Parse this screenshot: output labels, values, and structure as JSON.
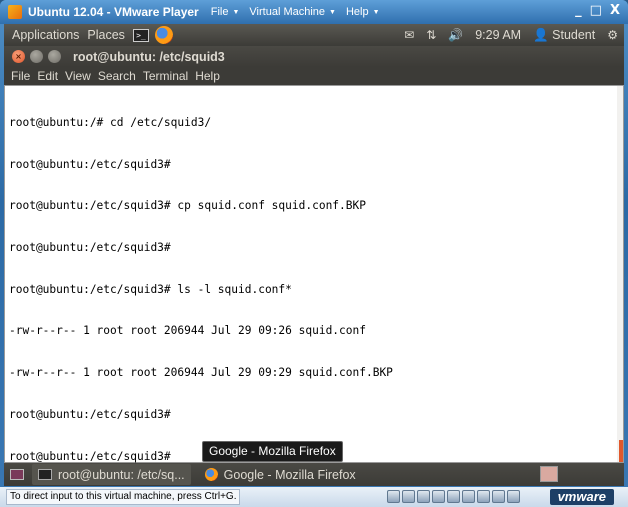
{
  "vmware": {
    "title": "Ubuntu 12.04 - VMware Player",
    "menus": [
      {
        "label": "File"
      },
      {
        "label": "Virtual Machine"
      },
      {
        "label": "Help"
      }
    ],
    "window_buttons": {
      "minimize": "_",
      "maximize": "□",
      "close": "X"
    },
    "status_text": "To direct input to this virtual machine, press Ctrl+G.",
    "brand": "vmware"
  },
  "ubuntu_panel": {
    "applications": "Applications",
    "places": "Places",
    "time": "9:29 AM",
    "user": "Student"
  },
  "terminal": {
    "title": "root@ubuntu: /etc/squid3",
    "menu": [
      "File",
      "Edit",
      "View",
      "Search",
      "Terminal",
      "Help"
    ],
    "lines": [
      "root@ubuntu:/# cd /etc/squid3/",
      "root@ubuntu:/etc/squid3#",
      "root@ubuntu:/etc/squid3# cp squid.conf squid.conf.BKP",
      "root@ubuntu:/etc/squid3#",
      "root@ubuntu:/etc/squid3# ls -l squid.conf*",
      "-rw-r--r-- 1 root root 206944 Jul 29 09:26 squid.conf",
      "-rw-r--r-- 1 root root 206944 Jul 29 09:29 squid.conf.BKP",
      "root@ubuntu:/etc/squid3#",
      "root@ubuntu:/etc/squid3#"
    ]
  },
  "tooltip": "Google - Mozilla Firefox",
  "taskbar": {
    "items": [
      {
        "label": "root@ubuntu: /etc/sq..."
      },
      {
        "label": "Google - Mozilla Firefox"
      }
    ]
  },
  "colors": {
    "ubuntu_panel": "#3c3b37",
    "terminal_bg": "#ffffff",
    "accent_orange": "#e0582c",
    "vmware_blue": "#2f6fae"
  }
}
